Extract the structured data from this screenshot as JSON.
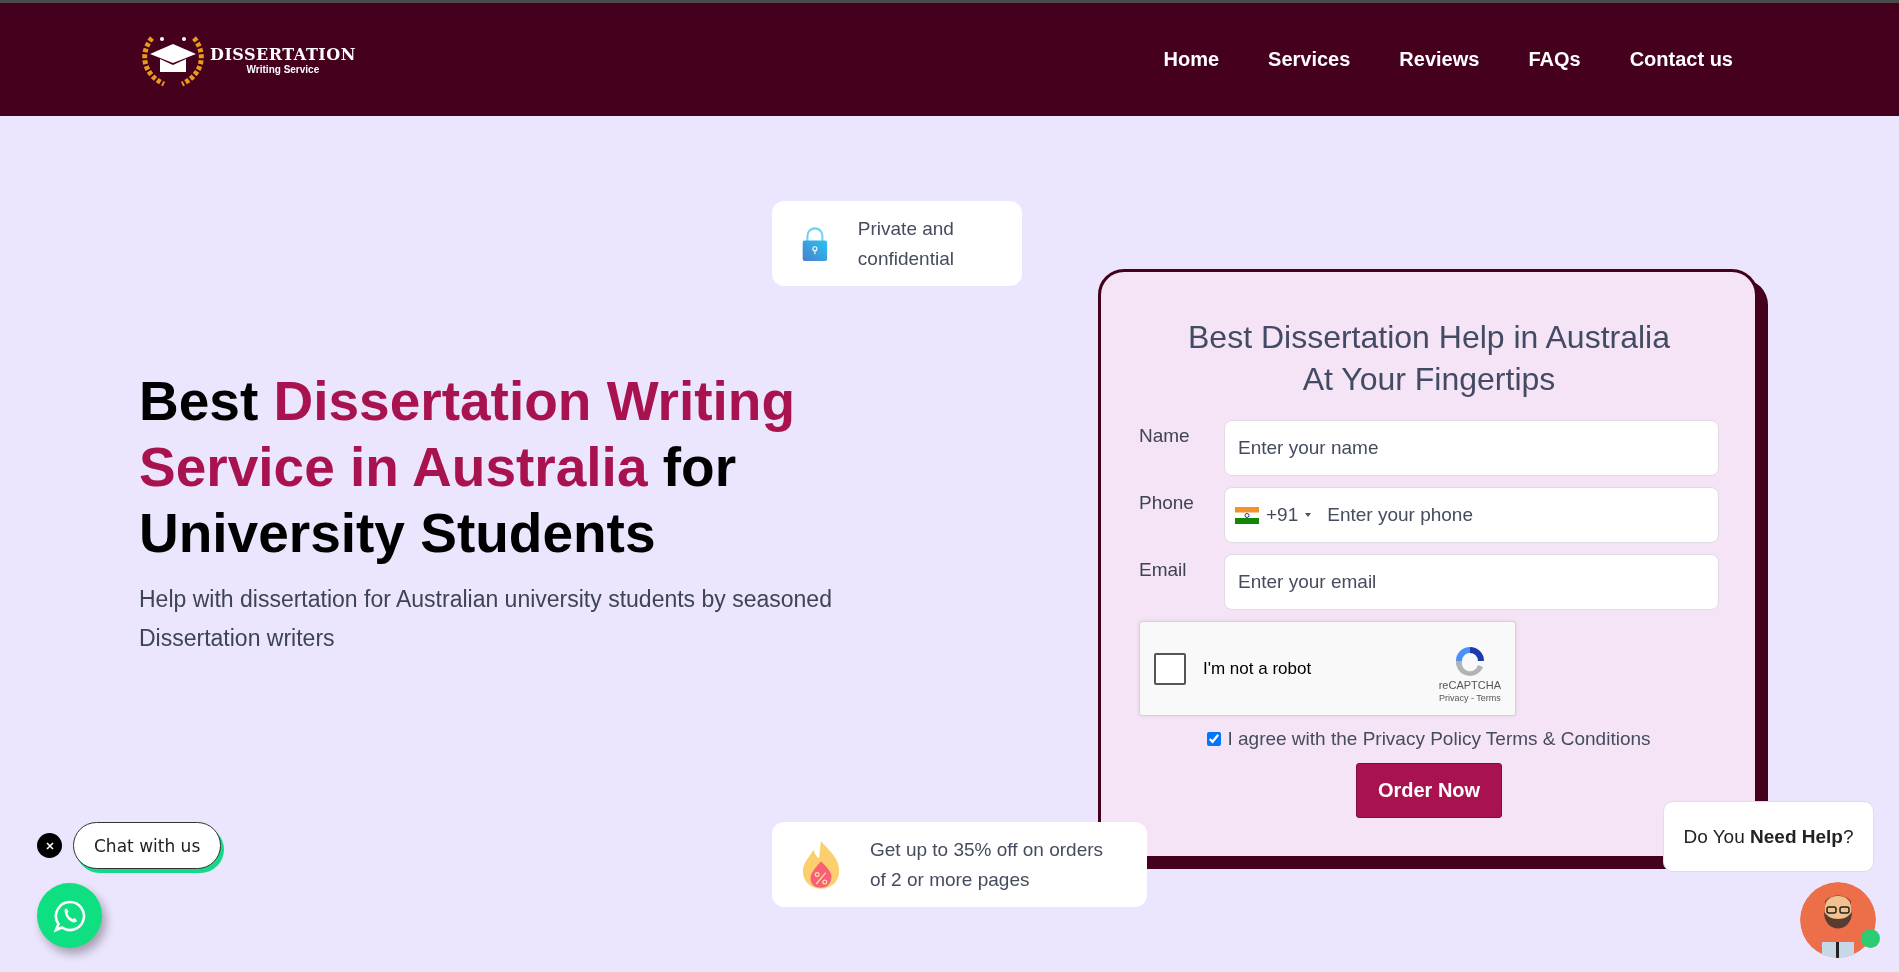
{
  "header": {
    "logo": {
      "title": "DISSERTATION",
      "subtitle": "Writing Service"
    },
    "nav": [
      {
        "label": "Home"
      },
      {
        "label": "Services"
      },
      {
        "label": "Reviews"
      },
      {
        "label": "FAQs"
      },
      {
        "label": "Contact us"
      }
    ]
  },
  "hero": {
    "heading": [
      {
        "text": "Best ",
        "highlight": false
      },
      {
        "text": "Dissertation Writing Service in Australia",
        "highlight": true
      },
      {
        "text": " for University Students",
        "highlight": false
      }
    ],
    "subheading": "Help with dissertation for Australian university students by seasoned Dissertation writers",
    "badges": [
      {
        "kind": "lock",
        "text": "Private and confidential"
      },
      {
        "kind": "fire",
        "text": "Get up to 35% off on orders of 2 or more pages"
      }
    ]
  },
  "form": {
    "title": "Best Dissertation Help in Australia At Your Fingertips",
    "fields": [
      {
        "kind": "text",
        "label": "Name",
        "placeholder": "Enter your name"
      },
      {
        "kind": "phone",
        "label": "Phone",
        "country_code": "+91",
        "placeholder": "Enter your phone"
      },
      {
        "kind": "text",
        "label": "Email",
        "placeholder": "Enter your email"
      }
    ],
    "captcha": {
      "checked": false,
      "label": "I'm not a robot",
      "brand": "reCAPTCHA",
      "links": "Privacy - Terms"
    },
    "agreement": {
      "checked": true,
      "text": "I agree with the Privacy Policy Terms & Conditions"
    },
    "submit": "Order Now"
  },
  "chat": {
    "label": "Chat with us"
  },
  "help": {
    "text": "Do You **Need Help**?",
    "online": true
  }
}
